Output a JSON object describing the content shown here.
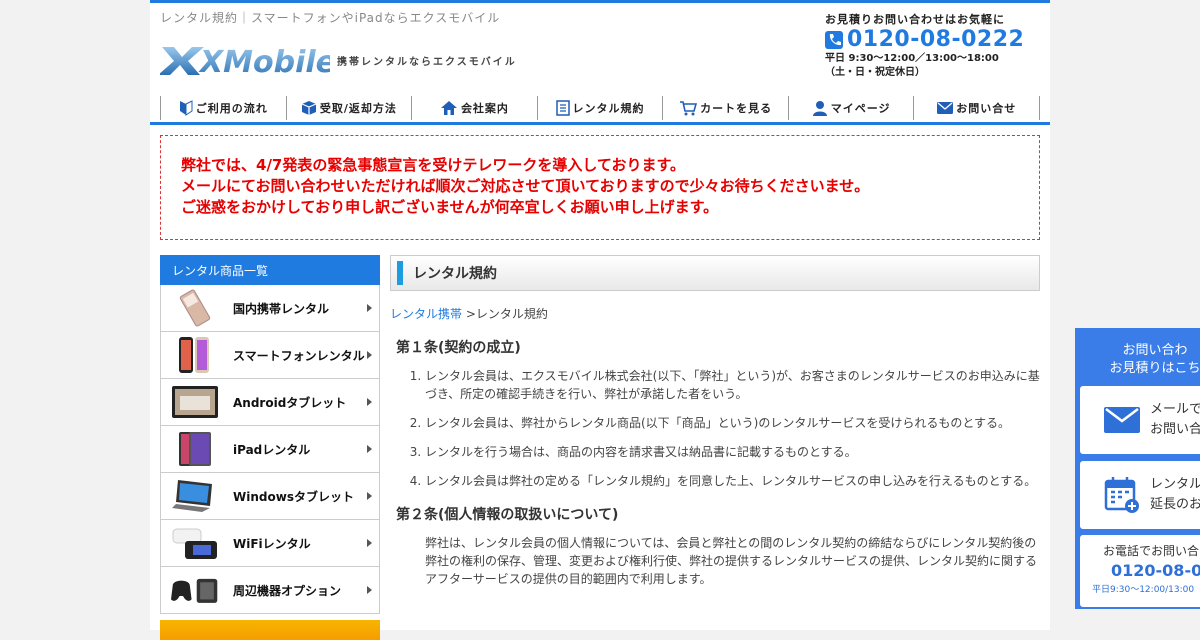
{
  "header": {
    "tagline": "レンタル規約｜スマートフォンやiPadならエクスモバイル",
    "logo_text": "XMobile",
    "logo_sub": "携帯レンタルならエクスモバイル",
    "contact_lead": "お見積りお問い合わせはお気軽に",
    "phone": "0120-08-0222",
    "hours1": "平日 9:30～12:00／13:00～18:00",
    "hours2": "（土・日・祝定休日）"
  },
  "nav": [
    {
      "label": "ご利用の流れ",
      "icon": "beginner-mark-icon"
    },
    {
      "label": "受取/返却方法",
      "icon": "box-icon"
    },
    {
      "label": "会社案内",
      "icon": "home-icon"
    },
    {
      "label": "レンタル規約",
      "icon": "document-icon"
    },
    {
      "label": "カートを見る",
      "icon": "cart-icon"
    },
    {
      "label": "マイページ",
      "icon": "user-icon"
    },
    {
      "label": "お問い合せ",
      "icon": "mail-icon"
    }
  ],
  "notice": {
    "line1": "弊社では、4/7発表の緊急事態宣言を受けテレワークを導入しております。",
    "line2": "メールにてお問い合わせいただければ順次ご対応させて頂いておりますので少々お待ちくださいませ。",
    "line3": "ご迷惑をおかけしており申し訳ございませんが何卒宜しくお願い申し上げます。"
  },
  "sidebar": {
    "heading": "レンタル商品一覧",
    "items": [
      {
        "label": "国内携帯レンタル",
        "icon": "feature-phone-icon"
      },
      {
        "label": "スマートフォンレンタル",
        "icon": "smartphone-icon"
      },
      {
        "label": "Androidタブレット",
        "icon": "android-tablet-icon"
      },
      {
        "label": "iPadレンタル",
        "icon": "ipad-icon"
      },
      {
        "label": "Windowsタブレット",
        "icon": "windows-tablet-icon"
      },
      {
        "label": "WiFiレンタル",
        "icon": "wifi-router-icon"
      },
      {
        "label": "周辺機器オプション",
        "icon": "accessories-icon"
      }
    ]
  },
  "main": {
    "title": "レンタル規約",
    "breadcrumb_link": "レンタル携帯",
    "breadcrumb_sep": " >",
    "breadcrumb_current": "レンタル規約",
    "article1": {
      "heading": "第１条(契約の成立)",
      "items": [
        "レンタル会員は、エクスモバイル株式会社(以下、「弊社」という)が、お客さまのレンタルサービスのお申込みに基づき、所定の確認手続きを行い、弊社が承諾した者をいう。",
        "レンタル会員は、弊社からレンタル商品(以下「商品」という)のレンタルサービスを受けられるものとする。",
        "レンタルを行う場合は、商品の内容を請求書又は納品書に記載するものとする。",
        "レンタル会員は弊社の定める「レンタル規約」を同意した上、レンタルサービスの申し込みを行えるものとする。"
      ]
    },
    "article2": {
      "heading": "第２条(個人情報の取扱いについて)",
      "body": "弊社は、レンタル会員の個人情報については、会員と弊社との間のレンタル契約の締結ならびにレンタル契約後の弊社の権利の保存、管理、変更および権利行使、弊社の提供するレンタルサービスの提供、レンタル契約に関するアフターサービスの提供の目的範囲内で利用します。"
    }
  },
  "float_panel": {
    "head1": "お問い合わ",
    "head2": "お見積りはこち",
    "mail_line1": "メールで",
    "mail_line2": "お問い合",
    "rental_line1": "レンタル",
    "rental_line2": "延長のお",
    "phone_lead": "お電話でお問い合",
    "phone": "0120-08-0",
    "phone_hours": "平日9:30～12:00/13:00"
  },
  "colors": {
    "accent": "#1f7be0",
    "notice": "#e60000",
    "float": "#3a7ce8"
  }
}
